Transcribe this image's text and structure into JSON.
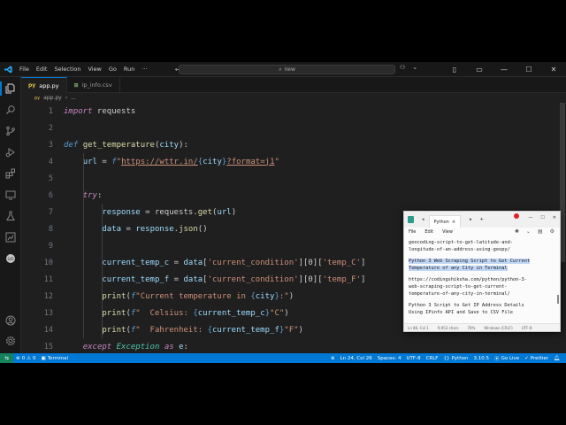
{
  "titlebar": {
    "menu": [
      "File",
      "Edit",
      "Selection",
      "View",
      "Go",
      "Run"
    ],
    "more": "···",
    "search": "new"
  },
  "tabs": [
    {
      "icon_text": "py",
      "label": "app.py",
      "active": true
    },
    {
      "icon_text": "⊞",
      "label": "ip_info.csv",
      "active": false
    }
  ],
  "breadcrumb": {
    "file": "app.py",
    "rest": "..."
  },
  "code_lines": [
    {
      "n": "1",
      "tokens": [
        {
          "c": "kw",
          "t": "import"
        },
        {
          "c": "",
          "t": " requests"
        }
      ]
    },
    {
      "n": "2",
      "tokens": []
    },
    {
      "n": "3",
      "tokens": [
        {
          "c": "def",
          "t": "def"
        },
        {
          "c": "",
          "t": " "
        },
        {
          "c": "fn",
          "t": "get_temperature"
        },
        {
          "c": "",
          "t": "("
        },
        {
          "c": "var",
          "t": "city"
        },
        {
          "c": "",
          "t": "):"
        }
      ]
    },
    {
      "n": "4",
      "tokens": [
        {
          "c": "",
          "t": "    "
        },
        {
          "c": "var",
          "t": "url"
        },
        {
          "c": "",
          "t": " = "
        },
        {
          "c": "fpre",
          "t": "f"
        },
        {
          "c": "str",
          "t": "\""
        },
        {
          "c": "strl",
          "t": "https://wttr.in/"
        },
        {
          "c": "brace",
          "t": "{"
        },
        {
          "c": "var",
          "t": "city"
        },
        {
          "c": "brace",
          "t": "}"
        },
        {
          "c": "strl",
          "t": "?format=j1"
        },
        {
          "c": "str",
          "t": "\""
        }
      ]
    },
    {
      "n": "5",
      "tokens": []
    },
    {
      "n": "6",
      "tokens": [
        {
          "c": "",
          "t": "    "
        },
        {
          "c": "kw",
          "t": "try"
        },
        {
          "c": "",
          "t": ":"
        }
      ]
    },
    {
      "n": "7",
      "tokens": [
        {
          "c": "",
          "t": "        "
        },
        {
          "c": "var",
          "t": "response"
        },
        {
          "c": "",
          "t": " = requests."
        },
        {
          "c": "fn",
          "t": "get"
        },
        {
          "c": "",
          "t": "("
        },
        {
          "c": "var",
          "t": "url"
        },
        {
          "c": "",
          "t": ")"
        }
      ]
    },
    {
      "n": "8",
      "tokens": [
        {
          "c": "",
          "t": "        "
        },
        {
          "c": "var",
          "t": "data"
        },
        {
          "c": "",
          "t": " = "
        },
        {
          "c": "var",
          "t": "response"
        },
        {
          "c": "",
          "t": "."
        },
        {
          "c": "fn",
          "t": "json"
        },
        {
          "c": "",
          "t": "()"
        }
      ]
    },
    {
      "n": "9",
      "tokens": []
    },
    {
      "n": "10",
      "tokens": [
        {
          "c": "",
          "t": "        "
        },
        {
          "c": "var",
          "t": "current_temp_c"
        },
        {
          "c": "",
          "t": " = "
        },
        {
          "c": "var",
          "t": "data"
        },
        {
          "c": "",
          "t": "["
        },
        {
          "c": "str",
          "t": "'current_condition'"
        },
        {
          "c": "",
          "t": "][0]["
        },
        {
          "c": "str",
          "t": "'temp_C'"
        },
        {
          "c": "",
          "t": "]"
        }
      ]
    },
    {
      "n": "11",
      "tokens": [
        {
          "c": "",
          "t": "        "
        },
        {
          "c": "var",
          "t": "current_temp_f"
        },
        {
          "c": "",
          "t": " = "
        },
        {
          "c": "var",
          "t": "data"
        },
        {
          "c": "",
          "t": "["
        },
        {
          "c": "str",
          "t": "'current_condition'"
        },
        {
          "c": "",
          "t": "][0]["
        },
        {
          "c": "str",
          "t": "'temp_F'"
        },
        {
          "c": "",
          "t": "]"
        }
      ]
    },
    {
      "n": "12",
      "tokens": [
        {
          "c": "",
          "t": "        "
        },
        {
          "c": "fn",
          "t": "print"
        },
        {
          "c": "",
          "t": "("
        },
        {
          "c": "fpre",
          "t": "f"
        },
        {
          "c": "str",
          "t": "\"Current temperature in "
        },
        {
          "c": "brace",
          "t": "{"
        },
        {
          "c": "var",
          "t": "city"
        },
        {
          "c": "brace",
          "t": "}"
        },
        {
          "c": "str",
          "t": ":\""
        },
        {
          "c": "",
          "t": ")"
        }
      ]
    },
    {
      "n": "13",
      "tokens": [
        {
          "c": "",
          "t": "        "
        },
        {
          "c": "fn",
          "t": "print"
        },
        {
          "c": "",
          "t": "("
        },
        {
          "c": "fpre",
          "t": "f"
        },
        {
          "c": "str",
          "t": "\"  Celsius: "
        },
        {
          "c": "brace",
          "t": "{"
        },
        {
          "c": "var",
          "t": "current_temp_c"
        },
        {
          "c": "brace",
          "t": "}"
        },
        {
          "c": "str",
          "t": "°C\""
        },
        {
          "c": "",
          "t": ")"
        }
      ]
    },
    {
      "n": "14",
      "tokens": [
        {
          "c": "",
          "t": "        "
        },
        {
          "c": "fn",
          "t": "print"
        },
        {
          "c": "",
          "t": "("
        },
        {
          "c": "fpre",
          "t": "f"
        },
        {
          "c": "str",
          "t": "\"  Fahrenheit: "
        },
        {
          "c": "brace",
          "t": "{"
        },
        {
          "c": "var",
          "t": "current_temp_f"
        },
        {
          "c": "brace",
          "t": "}"
        },
        {
          "c": "str",
          "t": "°F\""
        },
        {
          "c": "",
          "t": ")"
        }
      ]
    },
    {
      "n": "15",
      "tokens": [
        {
          "c": "",
          "t": "    "
        },
        {
          "c": "kw",
          "t": "except"
        },
        {
          "c": "",
          "t": " "
        },
        {
          "c": "cls",
          "t": "Exception"
        },
        {
          "c": "",
          "t": " "
        },
        {
          "c": "kw",
          "t": "as"
        },
        {
          "c": "",
          "t": " "
        },
        {
          "c": "var",
          "t": "e"
        },
        {
          "c": "",
          "t": ":"
        }
      ]
    }
  ],
  "statusbar": {
    "errors": "0",
    "warnings": "0",
    "terminal": "Terminal",
    "position": "Ln 24, Col 26",
    "spaces": "Spaces: 4",
    "encoding": "UTF-8",
    "eol": "CRLF",
    "language": "Python",
    "version": "3.10.5",
    "golive": "Go Live",
    "prettier": "Prettier"
  },
  "notepad": {
    "tab_label": "Python",
    "menu": [
      "File",
      "Edit",
      "View"
    ],
    "lines": [
      {
        "text": "geocoding-script-to-get-latitude-and-\nlongitude-of-an-address-using-geopy/",
        "selected": false
      },
      {
        "text": "Python 3 Web Scraping Script to Get Current\nTemperature of any City in Terminal",
        "selected": true
      },
      {
        "text": "https://codingshiksha.com/python/python-3-\nweb-scraping-script-to-get-current-\ntemperature-of-any-city-in-terminal/",
        "selected": false
      },
      {
        "text": "Python 3 Script to Get IP Address Details\nUsing IPinfo API and Save to CSV File",
        "selected": false
      }
    ],
    "status": [
      "Ln 86, Col 1",
      "9,953 chars",
      "78%",
      "Windows (CRLF)",
      "UTF-8"
    ]
  },
  "colors": {
    "editor_bg": "#1f1f1f",
    "statusbar_bg": "#0078d4",
    "keyword": "#c586c0",
    "function": "#dcdcaa",
    "variable": "#9cdcfe",
    "string": "#ce9178"
  }
}
